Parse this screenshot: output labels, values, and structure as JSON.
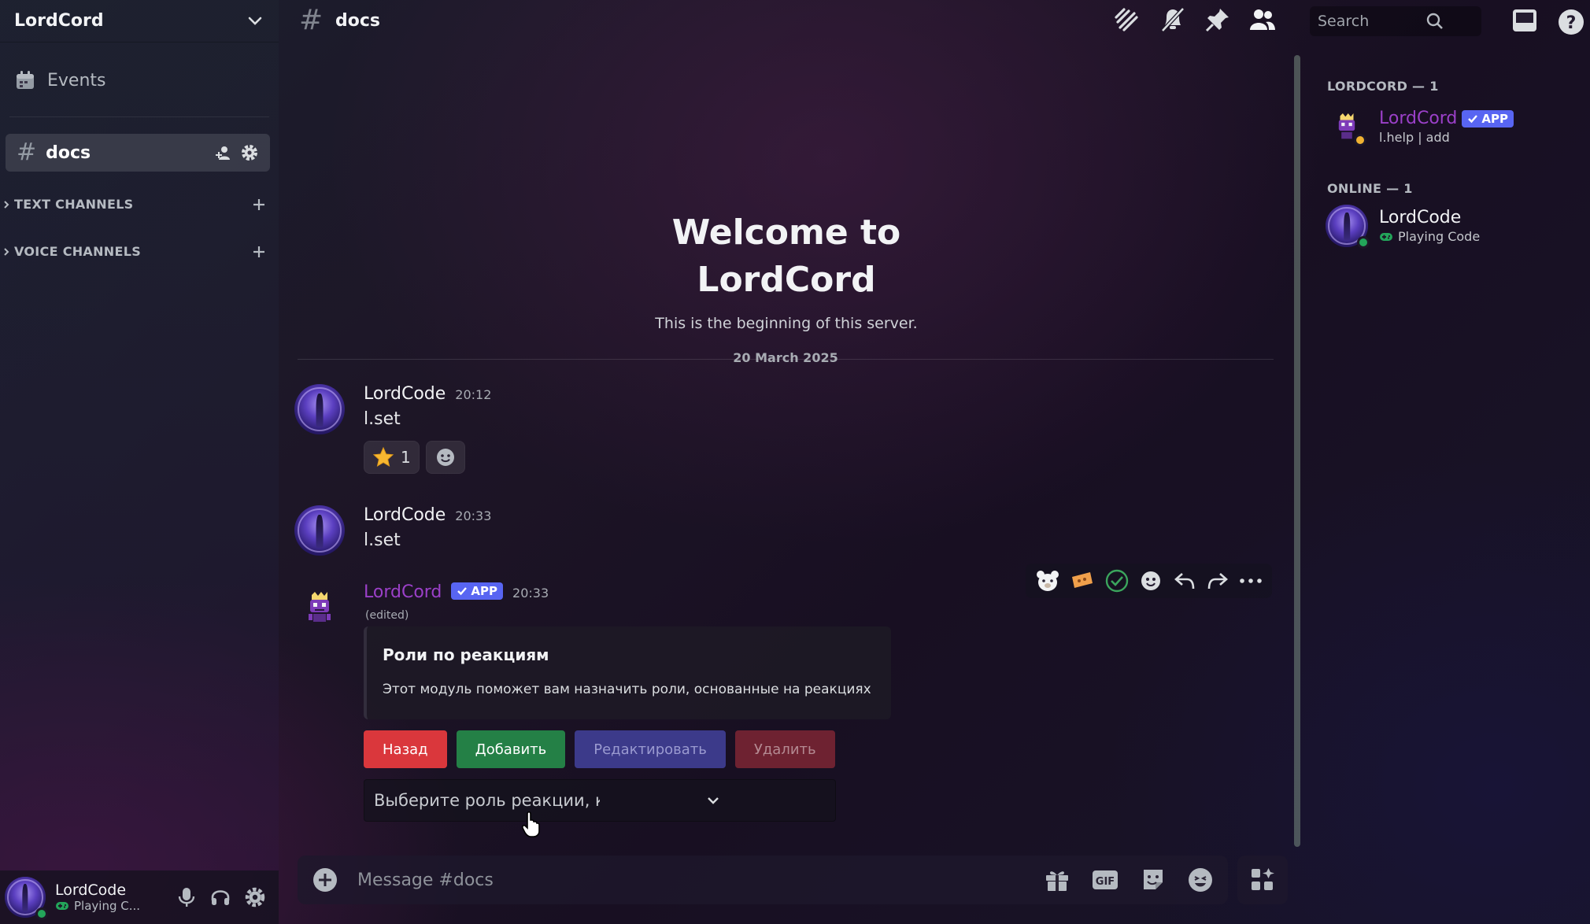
{
  "server": {
    "name": "LordCord"
  },
  "sidebar": {
    "events_label": "Events",
    "active_channel": "docs",
    "categories": [
      {
        "label": "TEXT CHANNELS"
      },
      {
        "label": "VOICE CHANNELS"
      }
    ]
  },
  "user_panel": {
    "name": "LordCode",
    "status": "Playing C..."
  },
  "topbar": {
    "channel_name": "docs",
    "search_placeholder": "Search"
  },
  "chat": {
    "welcome_title_line1": "Welcome to",
    "welcome_title_line2": "LordCord",
    "welcome_subtitle": "This is the beginning of this server.",
    "date_divider": "20 March 2025",
    "messages": [
      {
        "author": "LordCode",
        "time": "20:12",
        "text": "l.set",
        "reactions": [
          {
            "emoji": "star",
            "count": "1"
          }
        ]
      },
      {
        "author": "LordCode",
        "time": "20:33",
        "text": "l.set"
      },
      {
        "author": "LordCord",
        "badge": "APP",
        "time": "20:33",
        "edited": "(edited)",
        "embed": {
          "title": "Роли по реакциям",
          "description": "Этот модуль поможет вам назначить роли, основанные на реакциях"
        },
        "buttons": [
          "Назад",
          "Добавить",
          "Редактировать",
          "Удалить"
        ],
        "select_placeholder": "Выберите роль реакции, которую вы хотите изм..."
      }
    ]
  },
  "composer": {
    "placeholder": "Message #docs"
  },
  "members": {
    "groups": [
      {
        "label": "LORDCORD — 1",
        "members": [
          {
            "name": "LordCord",
            "badge": "APP",
            "sub": "l.help | add",
            "color": "#9b40c9"
          }
        ]
      },
      {
        "label": "ONLINE — 1",
        "members": [
          {
            "name": "LordCode",
            "sub": "Playing Code",
            "color": "#f2f3f5"
          }
        ]
      }
    ]
  },
  "colors": {
    "accent": "#5865f2",
    "online": "#23a55a",
    "danger": "#da373c",
    "success": "#248046",
    "bot_name": "#9b40c9"
  }
}
